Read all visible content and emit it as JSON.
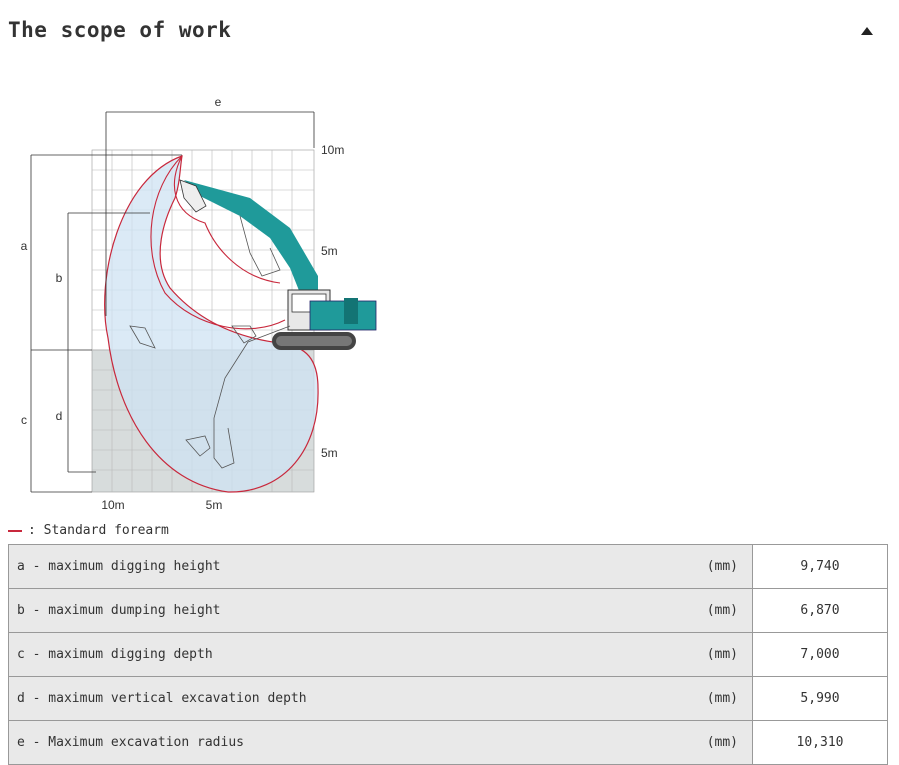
{
  "header": {
    "title": "The scope of work",
    "toggle_icon": "caret-up-icon"
  },
  "diagram": {
    "labels": {
      "a": "a",
      "b": "b",
      "c": "c",
      "d": "d",
      "e": "e"
    },
    "right_ticks": {
      "top": "10m",
      "mid": "5m",
      "bottom": "5m"
    },
    "bottom_ticks": {
      "left": "10m",
      "right": "5m"
    },
    "colors": {
      "reach_outline": "#c8283c",
      "upper_fill": "#dcecf8",
      "lower_fill": "#cad8e2",
      "machine": "#1f9a9a"
    }
  },
  "legend": {
    "marker": "—",
    "text": ": Standard forearm"
  },
  "specs": {
    "rows": [
      {
        "label": "a - maximum digging height",
        "unit": "(mm)",
        "value": "9,740"
      },
      {
        "label": "b - maximum dumping height",
        "unit": "(mm)",
        "value": "6,870"
      },
      {
        "label": "c - maximum digging depth",
        "unit": "(mm)",
        "value": "7,000"
      },
      {
        "label": "d - maximum vertical excavation depth",
        "unit": "(mm)",
        "value": "5,990"
      },
      {
        "label": "e - Maximum excavation radius",
        "unit": "(mm)",
        "value": "10,310"
      }
    ]
  }
}
